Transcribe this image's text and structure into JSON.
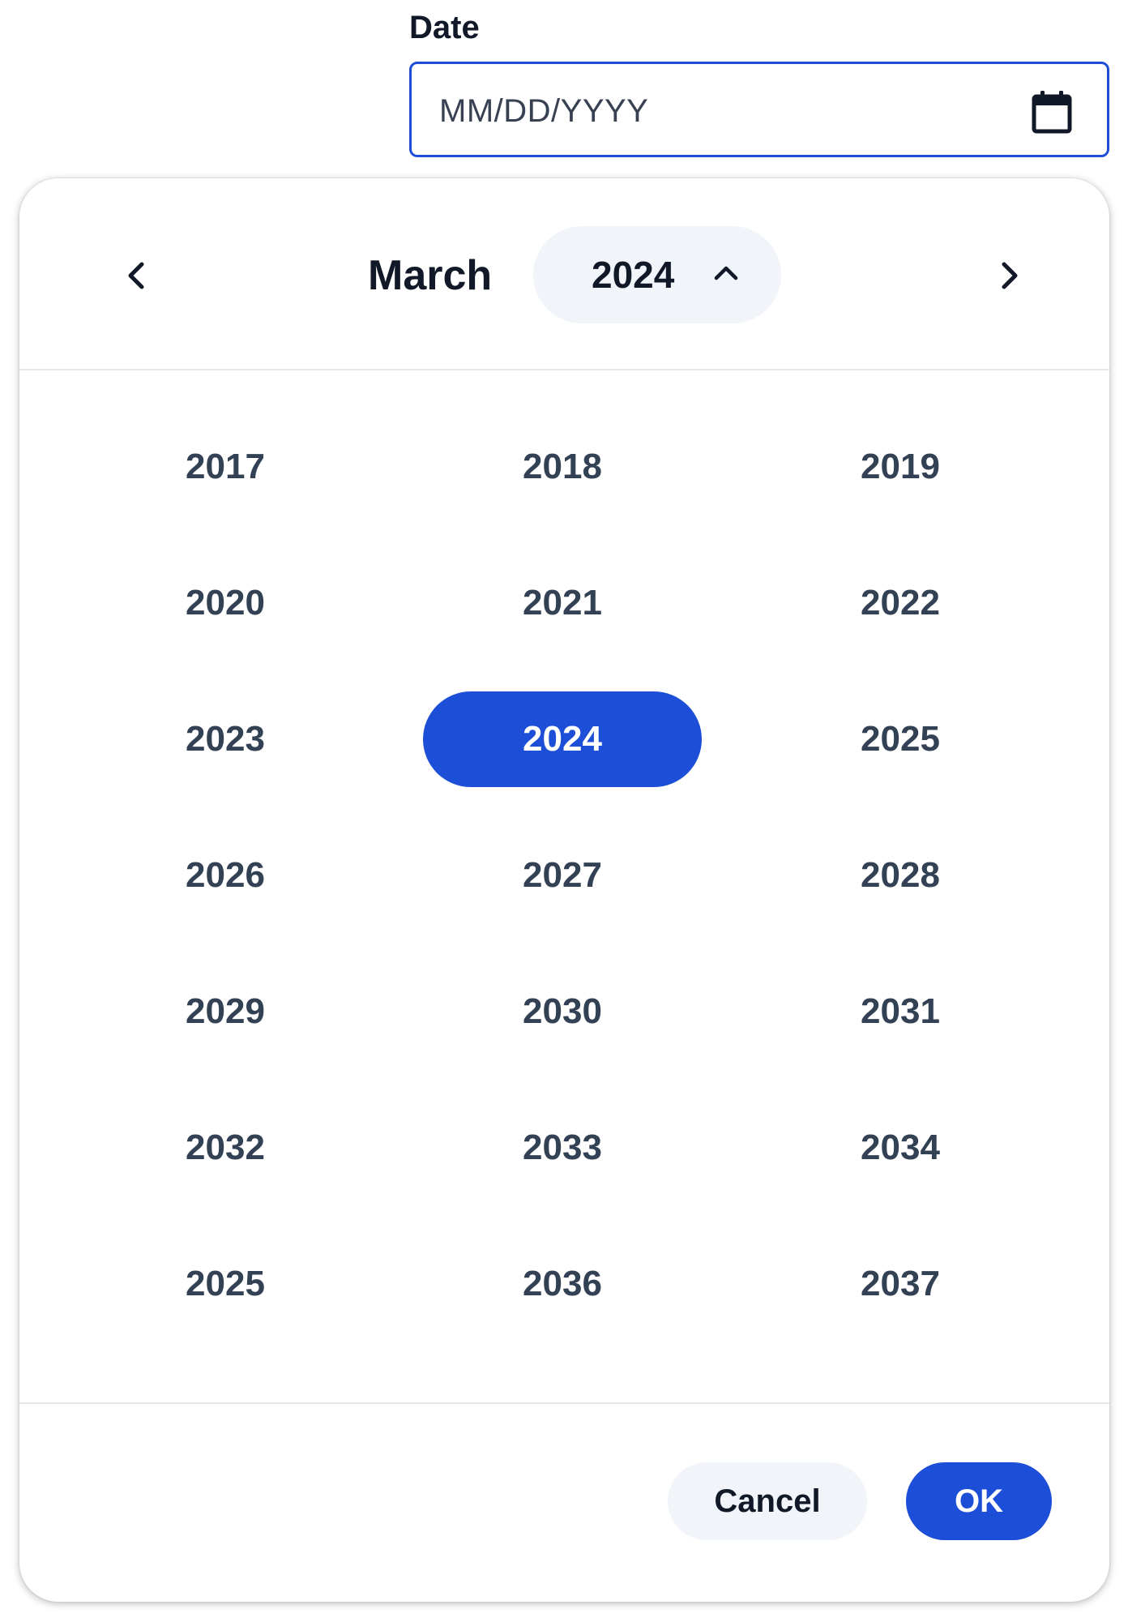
{
  "field": {
    "label": "Date",
    "placeholder": "MM/DD/YYYY",
    "icon": "calendar-icon"
  },
  "header": {
    "month": "March",
    "year": "2024",
    "prev_icon": "chevron-left-icon",
    "next_icon": "chevron-right-icon",
    "year_toggle_icon": "chevron-up-icon"
  },
  "years": [
    "2017",
    "2018",
    "2019",
    "2020",
    "2021",
    "2022",
    "2023",
    "2024",
    "2025",
    "2026",
    "2027",
    "2028",
    "2029",
    "2030",
    "2031",
    "2032",
    "2033",
    "2034",
    "2025",
    "2036",
    "2037"
  ],
  "selected_year": "2024",
  "footer": {
    "cancel_label": "Cancel",
    "ok_label": "OK"
  },
  "colors": {
    "accent": "#1d4ed8",
    "pill_bg": "#f1f4f8",
    "year_text": "#334155"
  }
}
